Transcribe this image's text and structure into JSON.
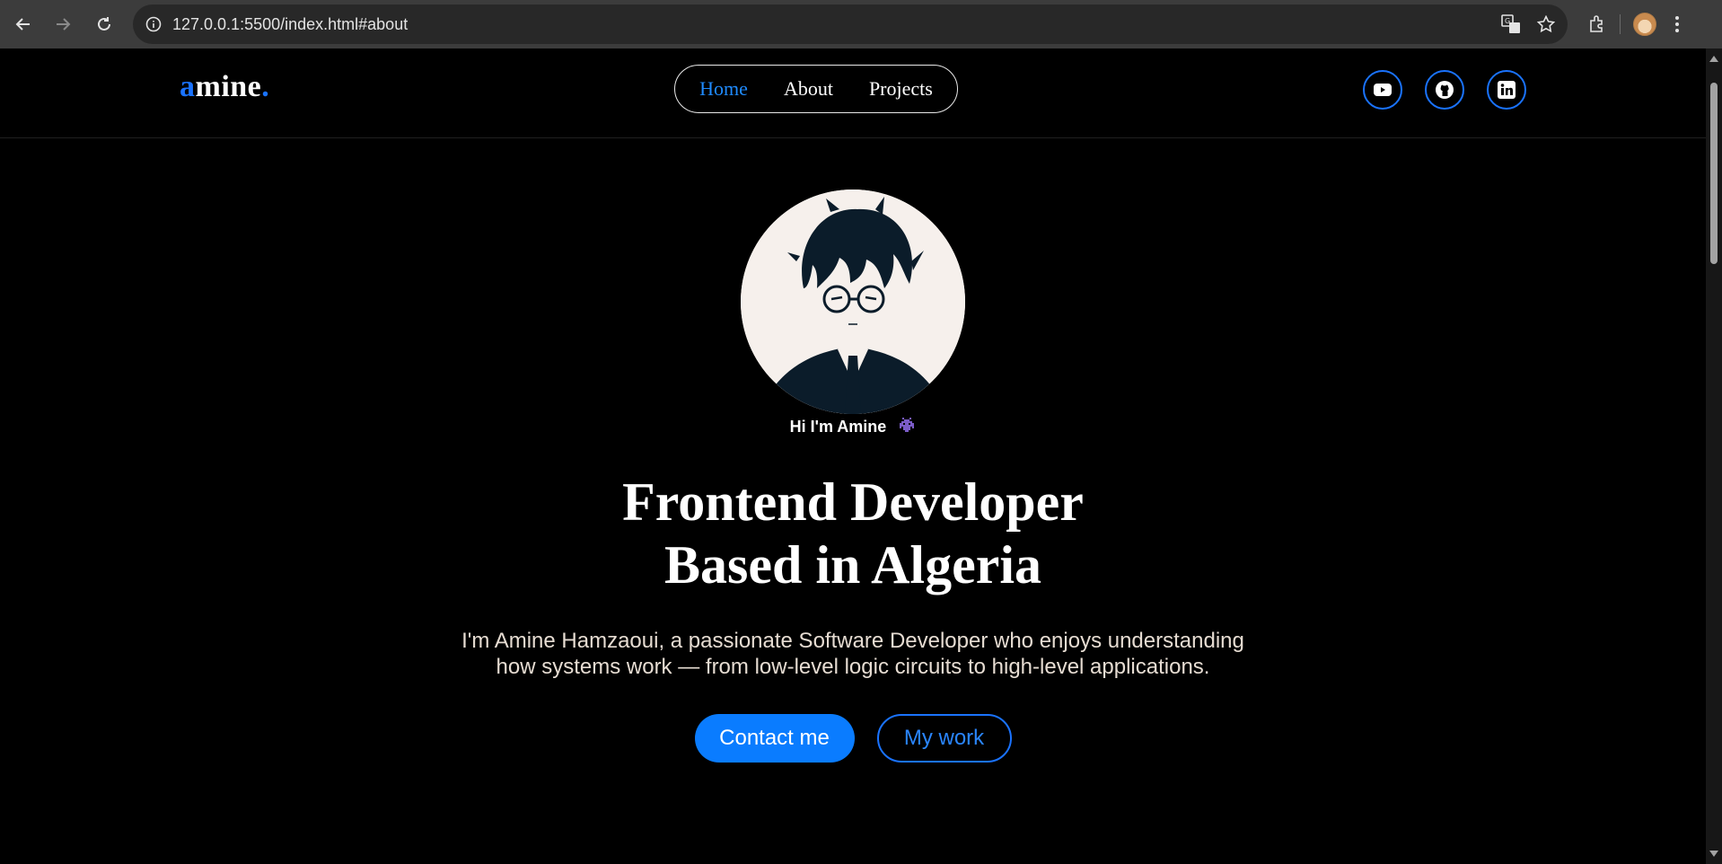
{
  "browser": {
    "url": "127.0.0.1:5500/index.html#about",
    "icons": [
      "back-icon",
      "forward-icon",
      "reload-icon",
      "site-info-icon",
      "translate-icon",
      "star-icon",
      "extensions-icon",
      "profile-avatar",
      "menu-icon"
    ]
  },
  "site": {
    "logo_first": "a",
    "logo_rest": "mine",
    "logo_dot": ".",
    "nav": [
      {
        "label": "Home",
        "active": true
      },
      {
        "label": "About",
        "active": false
      },
      {
        "label": "Projects",
        "active": false
      }
    ],
    "socials": [
      "youtube-icon",
      "github-icon",
      "linkedin-icon"
    ],
    "accent_color": "#1a73ff"
  },
  "hero": {
    "greeting": "Hi I'm Amine",
    "greeting_emoji": "alien-monster-icon",
    "headline_line1": "Frontend Developer",
    "headline_line2": "Based in Algeria",
    "intro_line1": "I'm Amine Hamzaoui, a passionate Software Developer who enjoys understanding",
    "intro_line2": "how systems work — from low-level logic circuits to high-level applications.",
    "primary_button": "Contact me",
    "secondary_button": "My work"
  }
}
